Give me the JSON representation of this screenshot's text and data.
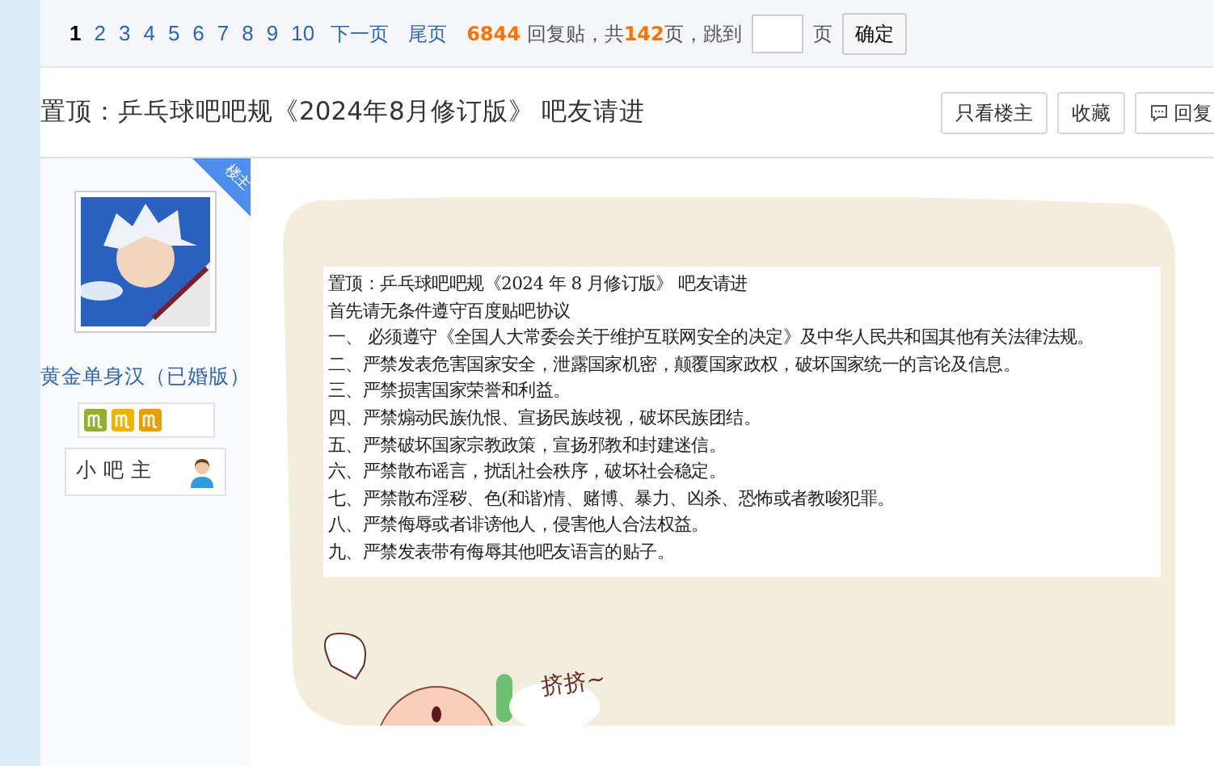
{
  "pager": {
    "pages": [
      {
        "label": "1",
        "selected": true
      },
      {
        "label": "2",
        "selected": false
      },
      {
        "label": "3",
        "selected": false
      },
      {
        "label": "4",
        "selected": false
      },
      {
        "label": "5",
        "selected": false
      },
      {
        "label": "6",
        "selected": false
      },
      {
        "label": "7",
        "selected": false
      },
      {
        "label": "8",
        "selected": false
      },
      {
        "label": "9",
        "selected": false
      },
      {
        "label": "10",
        "selected": false
      }
    ],
    "links": [
      "下一页",
      "尾页"
    ],
    "summary": "**6844** 回复贴，共**142**页，跳到",
    "page_unit": "页",
    "go_button": "确定"
  },
  "thread": {
    "title": "置顶：乒乓球吧吧规《2024年8月修订版》 吧友请进",
    "buttons": [
      {
        "label": "只看楼主",
        "kind": "plain"
      },
      {
        "label": "收藏",
        "kind": "plain"
      },
      {
        "label": "回复",
        "kind": "reply"
      }
    ]
  },
  "author": {
    "ribbon": "楼主",
    "name": "黄金单身汉（已婚版）",
    "badges": [
      {
        "color": "#8fb22a"
      },
      {
        "color": "#f0b400"
      },
      {
        "color": "#e8a000"
      }
    ],
    "role": "小 吧 主"
  },
  "post": {
    "rules": [
      "置顶：乒乓球吧吧规《2024 年 8 月修订版》  吧友请进",
      "首先请无条件遵守百度贴吧协议",
      "一、 必须遵守《全国人大常委会关于维护互联网安全的决定》及中华人民共和国其他有关法律法规。",
      "二、严禁发表危害国家安全，泄露国家机密，颠覆国家政权，破坏国家统一的言论及信息。",
      "三、严禁损害国家荣誉和利益。",
      "四、严禁煽动民族仇恨、宣扬民族歧视，破坏民族团结。",
      "五、严禁破坏国家宗教政策，宣扬邪教和封建迷信。",
      "六、严禁散布谣言，扰乱社会秩序，破坏社会稳定。",
      "七、严禁散布淫秽、色(和谐)情、赌博、暴力、凶杀、恐怖或者教唆犯罪。",
      "八、严禁侮辱或者诽谤他人，侵害他人合法权益。",
      "九、严禁发表带有侮辱其他吧友语言的贴子。"
    ],
    "sticker_text": "挤挤~"
  }
}
